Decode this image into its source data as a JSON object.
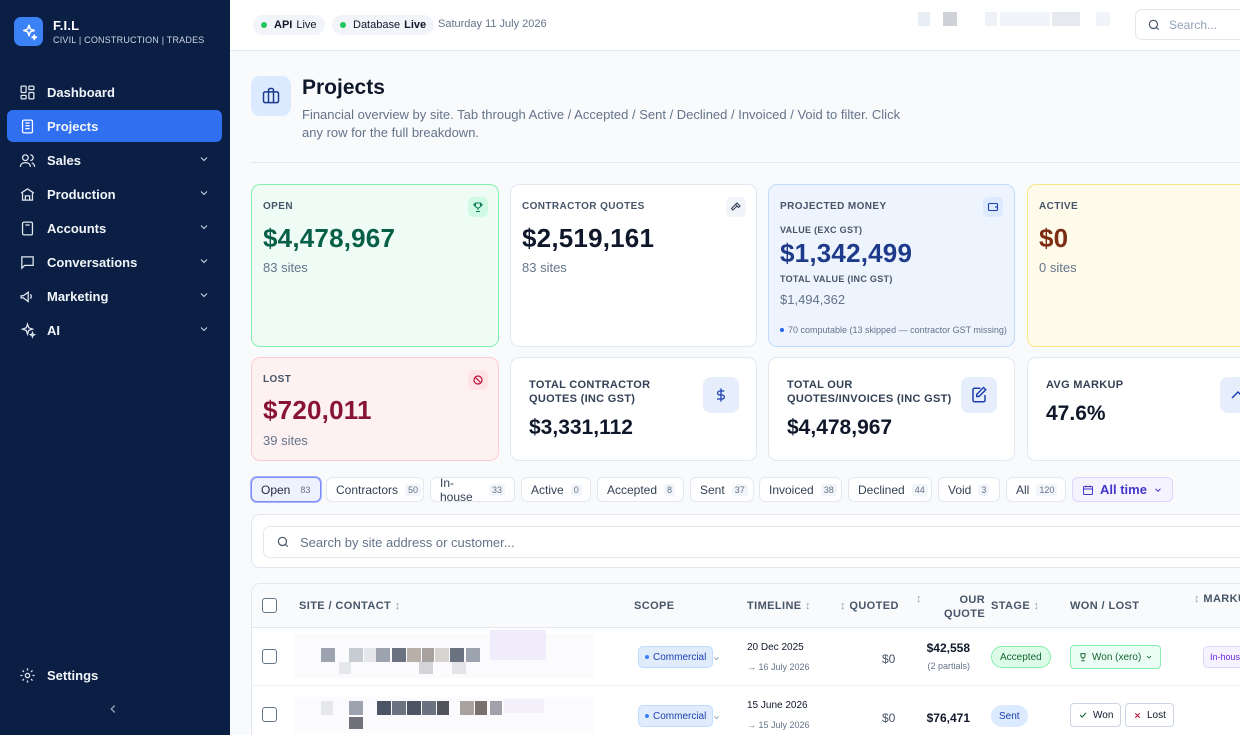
{
  "brand": {
    "name": "F.I.L",
    "subtitle": "CIVIL | CONSTRUCTION | TRADES"
  },
  "nav": [
    {
      "label": "Dashboard",
      "icon": "dashboard-icon"
    },
    {
      "label": "Projects",
      "icon": "projects-icon",
      "active": true
    },
    {
      "label": "Sales",
      "icon": "users-icon"
    },
    {
      "label": "Production",
      "icon": "truck-icon"
    },
    {
      "label": "Accounts",
      "icon": "calculator-icon"
    },
    {
      "label": "Conversations",
      "icon": "chat-icon"
    },
    {
      "label": "Marketing",
      "icon": "megaphone-icon"
    },
    {
      "label": "AI",
      "icon": "sparkles-icon"
    }
  ],
  "settings_label": "Settings",
  "topbar": {
    "status": [
      {
        "key": "API",
        "value": "Live"
      },
      {
        "key": "Database",
        "value": "Live"
      }
    ],
    "date": "Saturday 11 July 2026",
    "search_placeholder": "Search..."
  },
  "header": {
    "title": "Projects",
    "description": "Financial overview by site. Tab through Active / Accepted / Sent / Declined / Invoiced / Void to filter. Click any row for the full breakdown."
  },
  "cards": {
    "open": {
      "label": "OPEN",
      "value": "$4,478,967",
      "sub": "83 sites"
    },
    "contractor": {
      "label": "CONTRACTOR QUOTES",
      "value": "$2,519,161",
      "sub": "83 sites"
    },
    "projected": {
      "label": "PROJECTED MONEY",
      "value_label": "VALUE (EXC GST)",
      "value": "$1,342,499",
      "total_label": "TOTAL VALUE (INC GST)",
      "total": "$1,494,362",
      "note": "70 computable (13 skipped — contractor GST missing)"
    },
    "active": {
      "label": "ACTIVE",
      "value": "$0",
      "sub": "0 sites"
    },
    "lost": {
      "label": "LOST",
      "value": "$720,011",
      "sub": "39 sites"
    },
    "tcq": {
      "label": "TOTAL CONTRACTOR QUOTES (INC GST)",
      "value": "$3,331,112"
    },
    "toq": {
      "label": "TOTAL OUR QUOTES/INVOICES (INC GST)",
      "value": "$4,478,967"
    },
    "avg": {
      "label": "AVG MARKUP",
      "value": "47.6%"
    }
  },
  "tabs": [
    {
      "label": "Open",
      "count": "83"
    },
    {
      "label": "Contractors",
      "count": "50"
    },
    {
      "label": "In-house",
      "count": "33"
    },
    {
      "label": "Active",
      "count": "0"
    },
    {
      "label": "Accepted",
      "count": "8"
    },
    {
      "label": "Sent",
      "count": "37"
    },
    {
      "label": "Invoiced",
      "count": "38"
    },
    {
      "label": "Declined",
      "count": "44"
    },
    {
      "label": "Void",
      "count": "3"
    },
    {
      "label": "All",
      "count": "120"
    }
  ],
  "time_filter": "All time",
  "table_search_placeholder": "Search by site address or customer...",
  "columns": {
    "site": "SITE / CONTACT",
    "scope": "SCOPE",
    "timeline": "TIMELINE",
    "quoted": "QUOTED",
    "our_quote_1": "OUR",
    "our_quote_2": "QUOTE",
    "stage": "STAGE",
    "won_lost": "WON / LOST",
    "markup": "MARKU"
  },
  "rows": [
    {
      "scope": "Commercial",
      "timeline_start": "20 Dec 2025",
      "timeline_end": "→ 16 July 2026",
      "quoted": "$0",
      "our_quote": "$42,558",
      "our_quote_note": "(2 partials)",
      "stage": "Accepted",
      "won_lost": "Won (xero)",
      "markup": "In-hous"
    },
    {
      "scope": "Commercial",
      "timeline_start": "15 June 2026",
      "timeline_end": "→ 15 July 2026",
      "quoted": "$0",
      "our_quote": "$76,471",
      "stage": "Sent",
      "won": "Won",
      "lost": "Lost"
    }
  ]
}
